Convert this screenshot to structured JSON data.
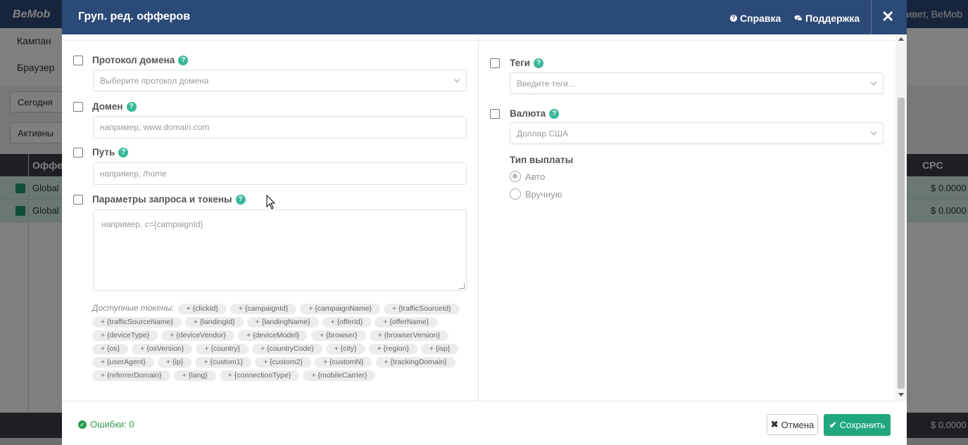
{
  "background": {
    "logo": "BeMob",
    "greeting": "ривет, BeMob",
    "nav": [
      "Кампан",
      "Браузер"
    ],
    "filters": [
      "Сегодня",
      "Активны"
    ],
    "table_header": {
      "first": "Оффер",
      "last": "CPC"
    },
    "rows": [
      {
        "name": "Global -",
        "cpc": "$ 0.0000"
      },
      {
        "name": "Global -",
        "cpc": "$ 0.0000"
      }
    ],
    "footer_cpc": "$ 0.0000"
  },
  "modal": {
    "title": "Груп. ред. офферов",
    "help_label": "Справка",
    "support_label": "Поддержка",
    "close_glyph": "✕"
  },
  "left": {
    "protocol": {
      "label": "Протокол домена",
      "placeholder": "Выберите протокол домена"
    },
    "domain": {
      "label": "Домен",
      "placeholder": "например, www.domain.com"
    },
    "path": {
      "label": "Путь",
      "placeholder": "например, /home"
    },
    "params": {
      "label": "Параметры запроса и токены",
      "placeholder": "например, c={campaignId}"
    },
    "tokens_label": "Доступные токены:",
    "tokens": [
      "+ {clickId}",
      "+ {campaignId}",
      "+ {campaignName}",
      "+ {trafficSourceId}",
      "+ {trafficSourceName}",
      "+ {landingId}",
      "+ {landingName}",
      "+ {offerId}",
      "+ {offerName}",
      "+ {deviceType}",
      "+ {deviceVendor}",
      "+ {deviceModel}",
      "+ {browser}",
      "+ {browserVersion}",
      "+ {os}",
      "+ {osVersion}",
      "+ {country}",
      "+ {countryCode}",
      "+ {city}",
      "+ {region}",
      "+ {isp}",
      "+ {userAgent}",
      "+ {ip}",
      "+ {custom1}",
      "+ {custom2}",
      "+ {customN}",
      "+ {trackingDomain}",
      "+ {referrerDomain}",
      "+ {lang}",
      "+ {connectionType}",
      "+ {mobileCarrier}"
    ]
  },
  "right": {
    "tags": {
      "label": "Теги",
      "placeholder": "Введите теги..."
    },
    "currency": {
      "label": "Валюта",
      "value": "Доллар США"
    },
    "payout": {
      "label": "Тип выплаты",
      "options": [
        {
          "label": "Авто",
          "selected": true
        },
        {
          "label": "Вручную",
          "selected": false
        }
      ]
    }
  },
  "footer": {
    "errors": "Ошибки: 0",
    "cancel_label": "Отмена",
    "save_label": "Сохранить"
  }
}
